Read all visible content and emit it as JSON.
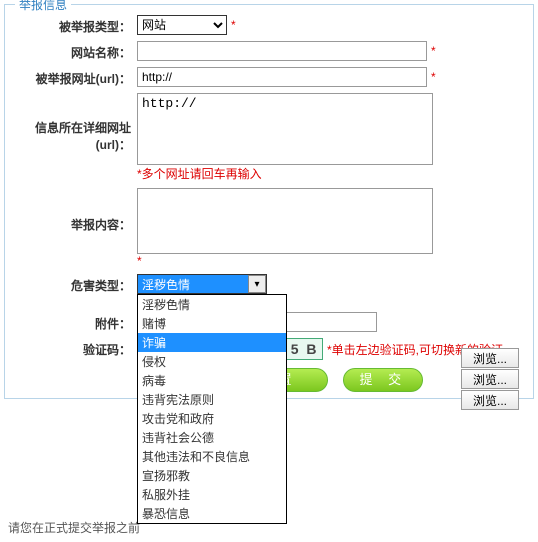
{
  "legend": "举报信息",
  "labels": {
    "type": "被举报类型：",
    "name": "网站名称：",
    "url": "被举报网址(url)：",
    "detail_url_1": "信息所在详细网址",
    "detail_url_2": "(url)：",
    "content": "举报内容：",
    "harm": "危害类型：",
    "attach": "附件：",
    "captcha": "验证码："
  },
  "type_select": "网站",
  "url_value": "http://",
  "detail_url_value": "http://",
  "multi_url_hint": "*多个网址请回车再输入",
  "harm_selected": "淫秽色情",
  "harm_options": [
    "淫秽色情",
    "赌博",
    "诈骗",
    "侵权",
    "病毒",
    "违背宪法原则",
    "攻击党和政府",
    "违背社会公德",
    "其他违法和不良信息",
    "宣扬邪教",
    "私服外挂",
    "暴恐信息"
  ],
  "harm_highlight_index": 2,
  "browse_label": "浏览...",
  "captcha_text": "*单击左边验证码,可切换新的验证",
  "captcha_val": "E 5 B",
  "reset_btn": "置",
  "submit_btn": "提  交",
  "footer": "请您在正式提交举报之前"
}
